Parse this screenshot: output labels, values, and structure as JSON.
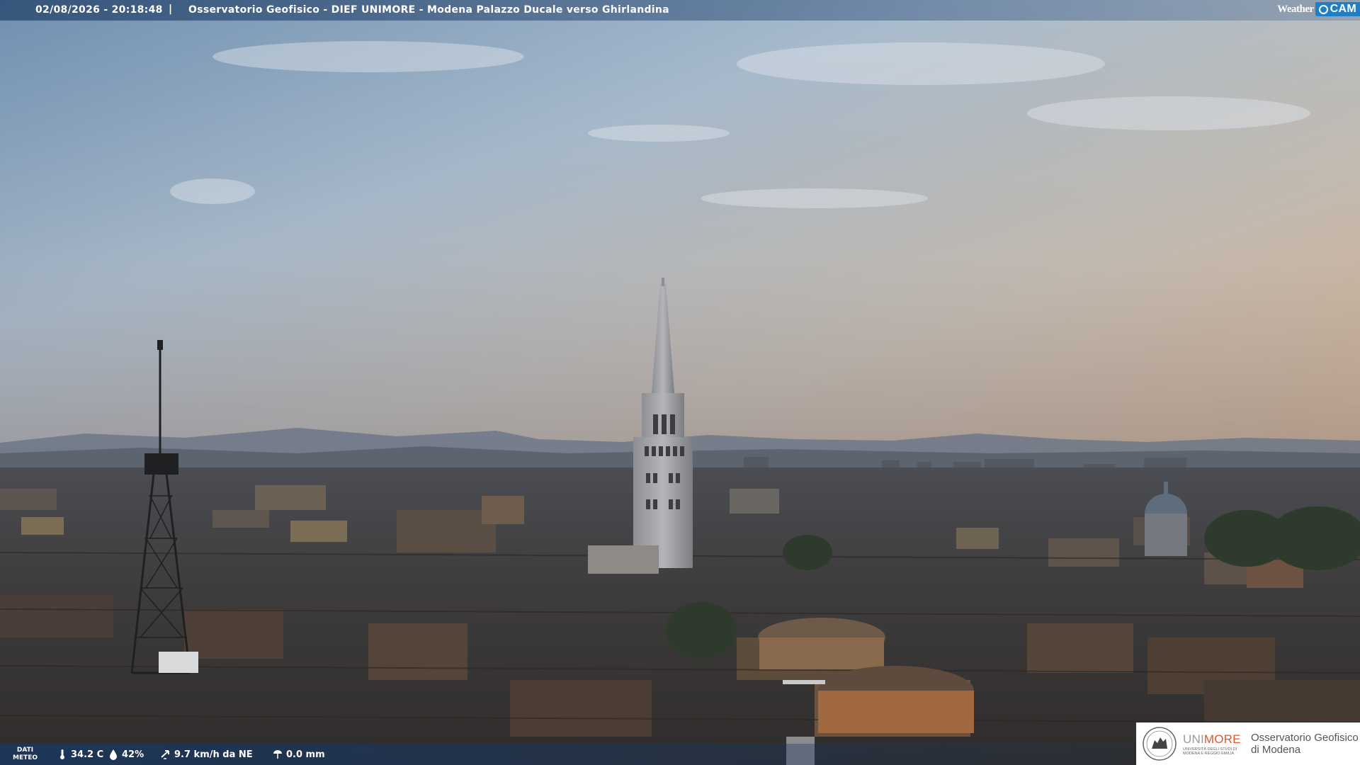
{
  "topbar": {
    "datetime": "02/08/2026 - 20:18:48",
    "separator": "|",
    "title": "Osservatorio Geofisico - DIEF UNIMORE - Modena Palazzo Ducale verso Ghirlandina"
  },
  "brand": {
    "weather": "Weather",
    "cam": "CAM",
    "accent": "#1e7fc8"
  },
  "meteo": {
    "label_line1": "DATI",
    "label_line2": "METEO",
    "temperature": "34.2 C",
    "humidity": "42%",
    "wind": "9.7 km/h da NE",
    "rain": "0.0 mm",
    "icons": [
      "thermometer-icon",
      "humidity-drop-icon",
      "wind-icon",
      "rain-gauge-icon"
    ]
  },
  "sponsor": {
    "uni_prefix": "UNI",
    "uni_suffix": "MORE",
    "uni_sub_line1": "UNIVERSITÀ DEGLI STUDI DI",
    "uni_sub_line2": "MODENA E REGGIO EMILIA",
    "observatory_line1": "Osservatorio Geofisico",
    "observatory_line2": "di Modena",
    "accent": "#e2562a"
  }
}
